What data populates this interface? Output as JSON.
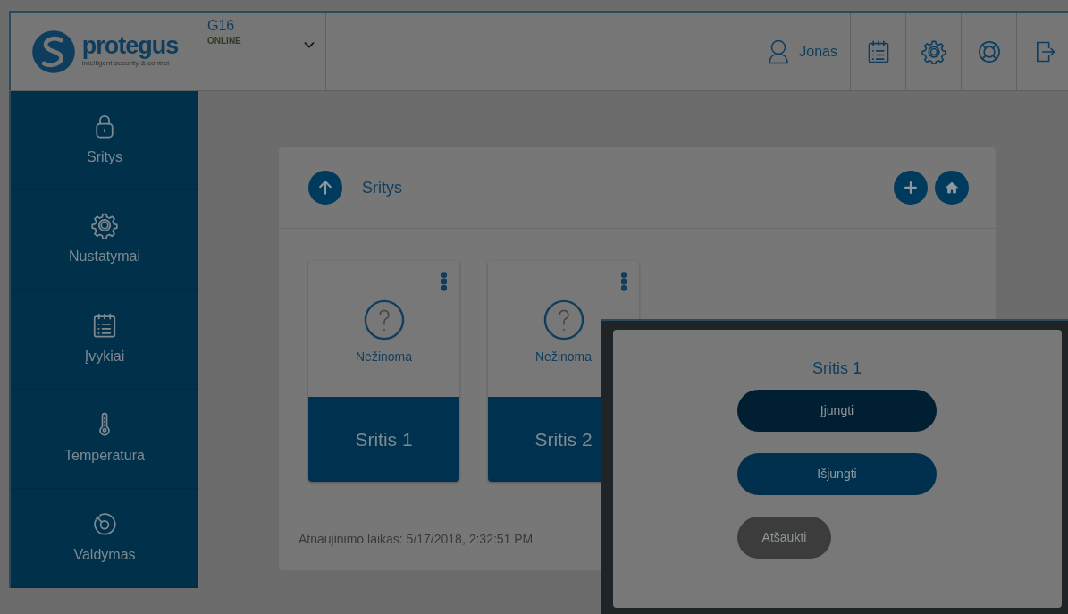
{
  "header": {
    "logo_text": "protegus",
    "logo_tagline": "intelligent security & control",
    "device": {
      "name": "G16",
      "status": "ONLINE"
    },
    "user": "Jonas",
    "tools": [
      {
        "kind": "calendar"
      },
      {
        "kind": "gear"
      },
      {
        "kind": "lifebuoy"
      },
      {
        "kind": "logout"
      }
    ]
  },
  "sidebar": {
    "items": [
      {
        "label": "Sritys",
        "kind": "lock"
      },
      {
        "label": "Nustatymai",
        "kind": "gear"
      },
      {
        "label": "Įvykiai",
        "kind": "calendar"
      },
      {
        "label": "Temperatūra",
        "kind": "thermometer"
      },
      {
        "label": "Valdymas",
        "kind": "dial"
      }
    ]
  },
  "panel": {
    "title": "Sritys",
    "areas": [
      {
        "status": "Nežinoma",
        "name": "Sritis 1"
      },
      {
        "status": "Nežinoma",
        "name": "Sritis 2"
      }
    ],
    "updated": "Atnaujinimo laikas: 5/17/2018, 2:32:51 PM"
  },
  "dialog": {
    "title": "Sritis 1",
    "buttons": [
      {
        "label": "Įjungti",
        "kind": "arm"
      },
      {
        "label": "Išjungti",
        "kind": "disarm"
      },
      {
        "label": "Atšaukti",
        "kind": "cancel"
      }
    ]
  }
}
